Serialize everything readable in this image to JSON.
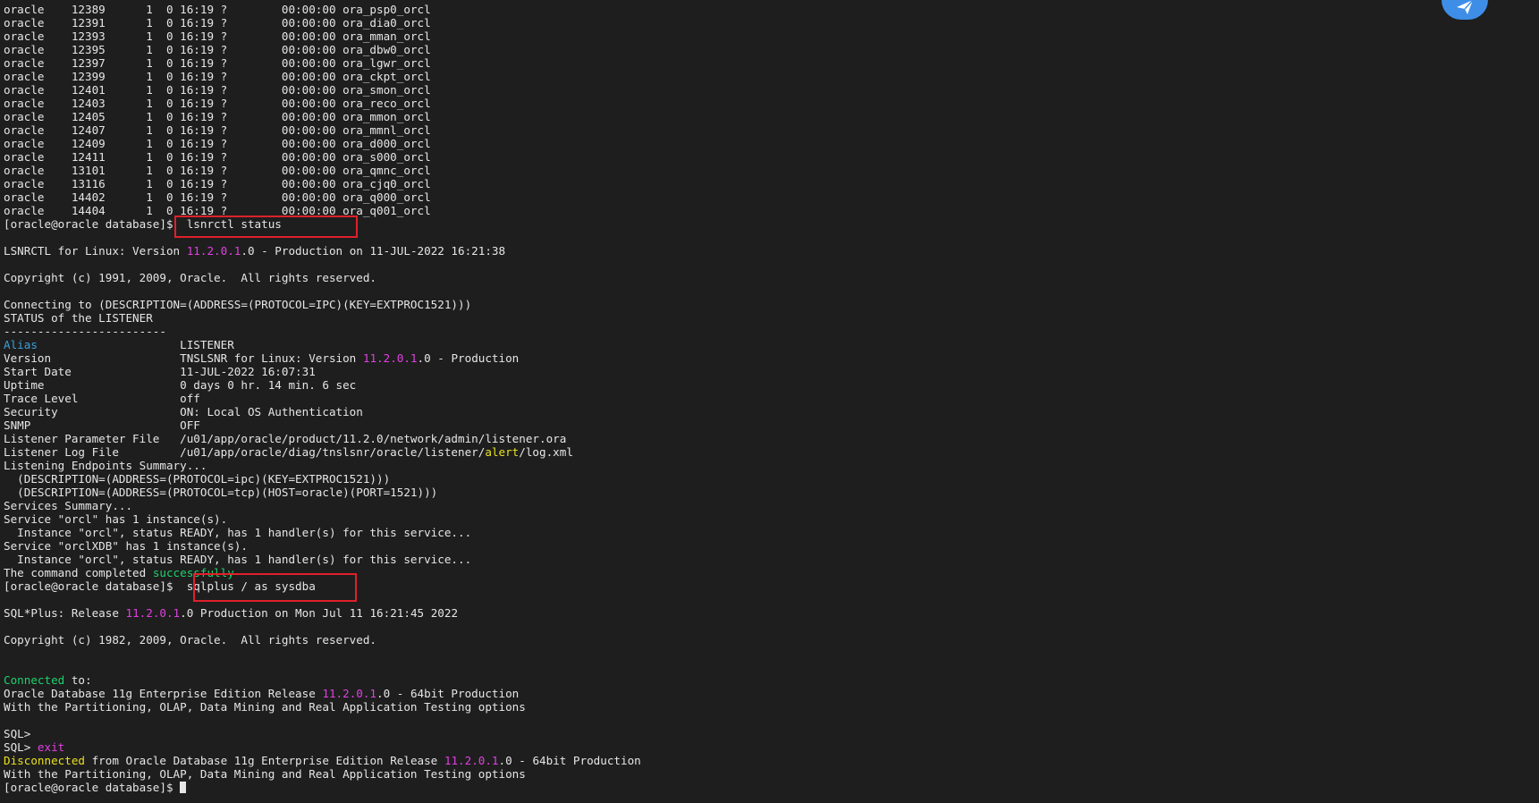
{
  "terminal": {
    "lines": [
      [
        {
          "t": "oracle    12389      1  0 16:19 ?        00:00:00 ora_psp0_orcl"
        }
      ],
      [
        {
          "t": "oracle    12391      1  0 16:19 ?        00:00:00 ora_dia0_orcl"
        }
      ],
      [
        {
          "t": "oracle    12393      1  0 16:19 ?        00:00:00 ora_mman_orcl"
        }
      ],
      [
        {
          "t": "oracle    12395      1  0 16:19 ?        00:00:00 ora_dbw0_orcl"
        }
      ],
      [
        {
          "t": "oracle    12397      1  0 16:19 ?        00:00:00 ora_lgwr_orcl"
        }
      ],
      [
        {
          "t": "oracle    12399      1  0 16:19 ?        00:00:00 ora_ckpt_orcl"
        }
      ],
      [
        {
          "t": "oracle    12401      1  0 16:19 ?        00:00:00 ora_smon_orcl"
        }
      ],
      [
        {
          "t": "oracle    12403      1  0 16:19 ?        00:00:00 ora_reco_orcl"
        }
      ],
      [
        {
          "t": "oracle    12405      1  0 16:19 ?        00:00:00 ora_mmon_orcl"
        }
      ],
      [
        {
          "t": "oracle    12407      1  0 16:19 ?        00:00:00 ora_mmnl_orcl"
        }
      ],
      [
        {
          "t": "oracle    12409      1  0 16:19 ?        00:00:00 ora_d000_orcl"
        }
      ],
      [
        {
          "t": "oracle    12411      1  0 16:19 ?        00:00:00 ora_s000_orcl"
        }
      ],
      [
        {
          "t": "oracle    13101      1  0 16:19 ?        00:00:00 ora_qmnc_orcl"
        }
      ],
      [
        {
          "t": "oracle    13116      1  0 16:19 ?        00:00:00 ora_cjq0_orcl"
        }
      ],
      [
        {
          "t": "oracle    14402      1  0 16:19 ?        00:00:00 ora_q000_orcl"
        }
      ],
      [
        {
          "t": "oracle    14404      1  0 16:19 ?        00:00:00 ora_q001_orcl"
        }
      ],
      [
        {
          "t": "[oracle@oracle database]$  lsnrctl status"
        }
      ],
      [
        {
          "t": ""
        }
      ],
      [
        {
          "t": "LSNRCTL for Linux: Version "
        },
        {
          "t": "11.2.0.1",
          "c": "mag"
        },
        {
          "t": ".0 - Production on 11-JUL-2022 16:21:38"
        }
      ],
      [
        {
          "t": ""
        }
      ],
      [
        {
          "t": "Copyright (c) 1991, 2009, Oracle.  All rights reserved."
        }
      ],
      [
        {
          "t": ""
        }
      ],
      [
        {
          "t": "Connecting to (DESCRIPTION=(ADDRESS=(PROTOCOL=IPC)(KEY=EXTPROC1521)))"
        }
      ],
      [
        {
          "t": "STATUS of the LISTENER"
        }
      ],
      [
        {
          "t": "------------------------"
        }
      ],
      [
        {
          "t": "Alias",
          "c": "blue"
        },
        {
          "t": "                     LISTENER"
        }
      ],
      [
        {
          "t": "Version                   TNSLSNR for Linux: Version "
        },
        {
          "t": "11.2.0.1",
          "c": "mag"
        },
        {
          "t": ".0 - Production"
        }
      ],
      [
        {
          "t": "Start Date                11-JUL-2022 16:07:31"
        }
      ],
      [
        {
          "t": "Uptime                    0 days 0 hr. 14 min. 6 sec"
        }
      ],
      [
        {
          "t": "Trace Level               off"
        }
      ],
      [
        {
          "t": "Security                  ON: Local OS Authentication"
        }
      ],
      [
        {
          "t": "SNMP                      OFF"
        }
      ],
      [
        {
          "t": "Listener Parameter File   /u01/app/oracle/product/11.2.0/network/admin/listener.ora"
        }
      ],
      [
        {
          "t": "Listener Log File         /u01/app/oracle/diag/tnslsnr/oracle/listener/"
        },
        {
          "t": "alert",
          "c": "yel"
        },
        {
          "t": "/log.xml"
        }
      ],
      [
        {
          "t": "Listening Endpoints Summary..."
        }
      ],
      [
        {
          "t": "  (DESCRIPTION=(ADDRESS=(PROTOCOL=ipc)(KEY=EXTPROC1521)))"
        }
      ],
      [
        {
          "t": "  (DESCRIPTION=(ADDRESS=(PROTOCOL=tcp)(HOST=oracle)(PORT=1521)))"
        }
      ],
      [
        {
          "t": "Services Summary..."
        }
      ],
      [
        {
          "t": "Service \"orcl\" has 1 instance(s)."
        }
      ],
      [
        {
          "t": "  Instance \"orcl\", status READY, has 1 handler(s) for this service..."
        }
      ],
      [
        {
          "t": "Service \"orclXDB\" has 1 instance(s)."
        }
      ],
      [
        {
          "t": "  Instance \"orcl\", status READY, has 1 handler(s) for this service..."
        }
      ],
      [
        {
          "t": "The command completed "
        },
        {
          "t": "successfully",
          "c": "grn"
        }
      ],
      [
        {
          "t": "[oracle@oracle database]$  sqlplus / as sysdba"
        }
      ],
      [
        {
          "t": ""
        }
      ],
      [
        {
          "t": "SQL*Plus: Release "
        },
        {
          "t": "11.2.0.1",
          "c": "mag"
        },
        {
          "t": ".0 Production on Mon Jul 11 16:21:45 2022"
        }
      ],
      [
        {
          "t": ""
        }
      ],
      [
        {
          "t": "Copyright (c) 1982, 2009, Oracle.  All rights reserved."
        }
      ],
      [
        {
          "t": ""
        }
      ],
      [
        {
          "t": ""
        }
      ],
      [
        {
          "t": "Connected",
          "c": "grn"
        },
        {
          "t": " to:"
        }
      ],
      [
        {
          "t": "Oracle Database 11g Enterprise Edition Release "
        },
        {
          "t": "11.2.0.1",
          "c": "mag"
        },
        {
          "t": ".0 - 64bit Production"
        }
      ],
      [
        {
          "t": "With the Partitioning, OLAP, Data Mining and Real Application Testing options"
        }
      ],
      [
        {
          "t": ""
        }
      ],
      [
        {
          "t": "SQL>"
        }
      ],
      [
        {
          "t": "SQL> "
        },
        {
          "t": "exit",
          "c": "mag"
        }
      ],
      [
        {
          "t": "Disconnected",
          "c": "yel"
        },
        {
          "t": " from Oracle Database 11g Enterprise Edition Release "
        },
        {
          "t": "11.2.0.1",
          "c": "mag"
        },
        {
          "t": ".0 - 64bit Production"
        }
      ],
      [
        {
          "t": "With the Partitioning, OLAP, Data Mining and Real Application Testing options"
        }
      ],
      [
        {
          "t": "[oracle@oracle database]$ "
        }
      ]
    ]
  },
  "colors": {
    "background": "#1e1e1e",
    "text": "#e6e6e6",
    "highlight_box": "#e0202a",
    "version_magenta": "#e040e0",
    "success_green": "#1fd06a",
    "keyword_yellow": "#e8e020",
    "alias_blue": "#3aa0d8"
  },
  "icons": {
    "corner_widget": "send-arrow-icon",
    "cursor": "block-cursor"
  }
}
